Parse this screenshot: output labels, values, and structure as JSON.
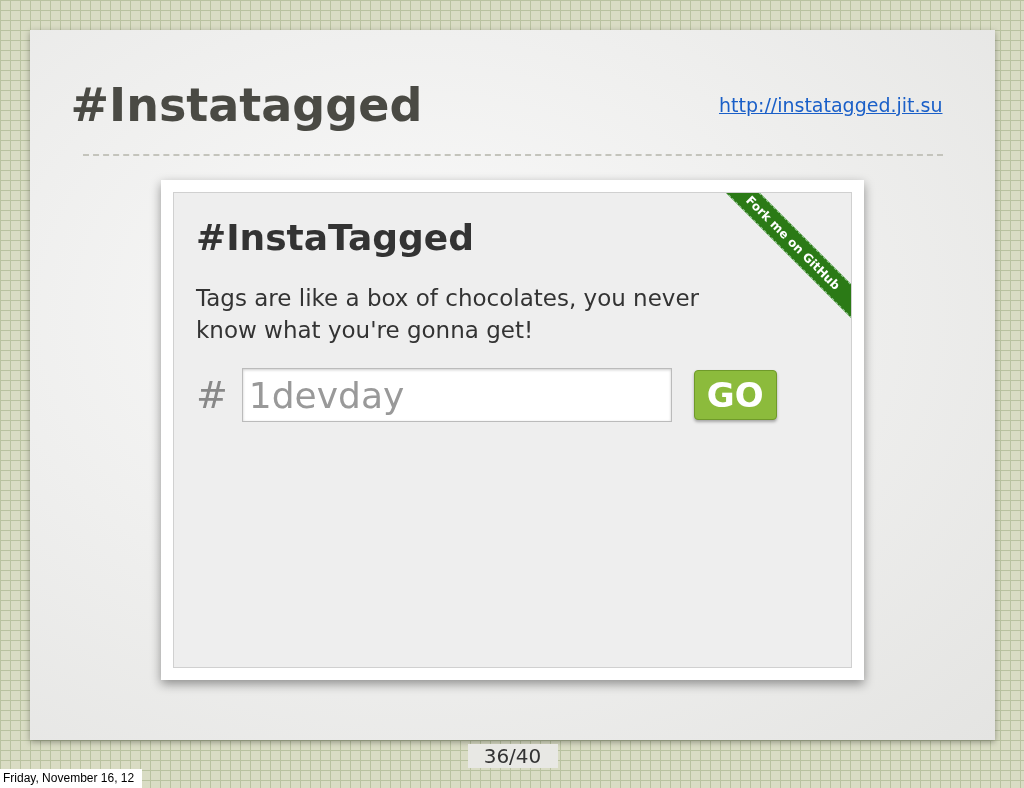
{
  "slide": {
    "title": "#Instatagged",
    "link": "http://instatagged.jit.su",
    "page_number": "36/40"
  },
  "web_page": {
    "heading": "#InstaTagged",
    "tagline": "Tags are like a box of chocolates, you never know what you're gonna get!",
    "hash_label": "#",
    "search": {
      "placeholder": "1devday"
    },
    "go_button": "GO",
    "ribbon": "Fork me on GitHub"
  },
  "footer": {
    "date": "Friday, November 16, 12"
  }
}
